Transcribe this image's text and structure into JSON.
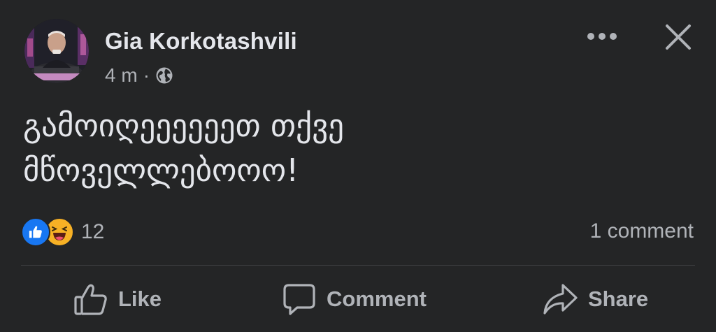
{
  "post": {
    "author": {
      "name": "Gia Korkotashvili",
      "avatar_icon": "profile-photo"
    },
    "meta": {
      "time": "4 m",
      "separator": "·",
      "audience_icon": "globe-icon"
    },
    "header_actions": {
      "more_icon": "more-horizontal-icon",
      "close_icon": "close-icon"
    },
    "text": "გამოიღეეეეეეთ თქვე\nმწოველლებოოო!",
    "reactions": {
      "icons": [
        "like-reaction-icon",
        "haha-reaction-icon"
      ],
      "count": "12"
    },
    "comments": {
      "label": "1 comment"
    },
    "actions": {
      "like_label": "Like",
      "comment_label": "Comment",
      "share_label": "Share"
    },
    "colors": {
      "background": "#242526",
      "primary_text": "#e4e6eb",
      "secondary_text": "#b0b3b8",
      "like_blue": "#1877f2",
      "haha_yellow": "#f7b125",
      "divider": "#3e4042"
    }
  }
}
